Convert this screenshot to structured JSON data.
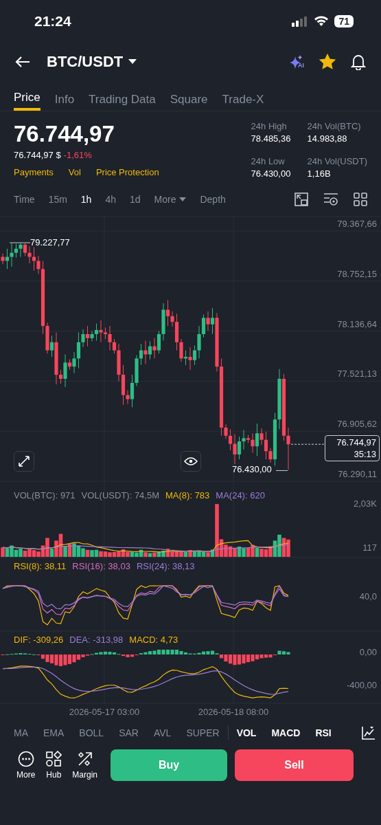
{
  "status_bar": {
    "time": "21:24",
    "battery": "71"
  },
  "header": {
    "pair": "BTC/USDT",
    "ai_label": "AI",
    "favorite": true
  },
  "tabs": [
    {
      "label": "Price",
      "selected": true
    },
    {
      "label": "Info",
      "selected": false
    },
    {
      "label": "Trading Data",
      "selected": false
    },
    {
      "label": "Square",
      "selected": false
    },
    {
      "label": "Trade-X",
      "selected": false
    }
  ],
  "price": {
    "last": "76.744,97",
    "fiat": "76.744,97 $",
    "change": "-1,61%",
    "links": [
      "Payments",
      "Vol",
      "Price Protection"
    ]
  },
  "stats": [
    {
      "label": "24h High",
      "value": "78.485,36"
    },
    {
      "label": "24h Vol(BTC)",
      "value": "14.983,88"
    },
    {
      "label": "24h Low",
      "value": "76.430,00"
    },
    {
      "label": "24h Vol(USDT)",
      "value": "1,16B"
    }
  ],
  "intervals": [
    {
      "label": "Time",
      "selected": false
    },
    {
      "label": "15m",
      "selected": false
    },
    {
      "label": "1h",
      "selected": true
    },
    {
      "label": "4h",
      "selected": false
    },
    {
      "label": "1d",
      "selected": false
    },
    {
      "label": "More",
      "selected": false,
      "kind": "dropdown"
    },
    {
      "label": "Depth",
      "selected": false
    }
  ],
  "price_chart": {
    "high_label": "79.227,77",
    "low_label": "76.430,00",
    "current_price": "76.744,97",
    "countdown": "35:13",
    "chart_data": {
      "type": "candlestick",
      "grid": true,
      "yticks": [
        {
          "value": 79367.66,
          "label": "79.367,66"
        },
        {
          "value": 78752.15,
          "label": "78.752,15"
        },
        {
          "value": 78136.64,
          "label": "78.136,64"
        },
        {
          "value": 77521.13,
          "label": "77.521,13"
        },
        {
          "value": 76905.62,
          "label": "76.905,62"
        },
        {
          "value": 76290.11,
          "label": "76.290,11"
        }
      ],
      "ylim": [
        76214.2,
        79553.7
      ],
      "ohlc": [
        [
          79050,
          79090,
          78960,
          79000
        ],
        [
          79000,
          79150,
          78900,
          79050
        ],
        [
          79050,
          79220,
          78930,
          79100
        ],
        [
          79100,
          79210,
          79040,
          79150
        ],
        [
          79150,
          79227.77,
          79050,
          79200
        ],
        [
          79200,
          79220,
          79060,
          79100
        ],
        [
          79100,
          79180,
          78970,
          79050
        ],
        [
          79050,
          79170,
          78880,
          79000
        ],
        [
          79000,
          79060,
          78840,
          78900
        ],
        [
          78900,
          79000,
          78100,
          78200
        ],
        [
          78200,
          78240,
          77860,
          77900
        ],
        [
          77900,
          78080,
          77820,
          78000
        ],
        [
          78000,
          78120,
          77480,
          77600
        ],
        [
          77600,
          77660,
          77490,
          77550
        ],
        [
          77550,
          77850,
          77450,
          77750
        ],
        [
          77750,
          77790,
          77660,
          77700
        ],
        [
          77700,
          77880,
          77620,
          77800
        ],
        [
          77800,
          78120,
          77680,
          78000
        ],
        [
          78000,
          78160,
          77940,
          78100
        ],
        [
          78100,
          78200,
          77950,
          78050
        ],
        [
          78050,
          78140,
          78010,
          78100
        ],
        [
          78100,
          78230,
          78020,
          78150
        ],
        [
          78150,
          78270,
          78000,
          78120
        ],
        [
          78120,
          78180,
          78040,
          78100
        ],
        [
          78100,
          78200,
          77900,
          78000
        ],
        [
          78000,
          78040,
          77860,
          77900
        ],
        [
          77900,
          77980,
          77520,
          77600
        ],
        [
          77600,
          77720,
          77230,
          77350
        ],
        [
          77350,
          77410,
          77240,
          77300
        ],
        [
          77300,
          77600,
          77200,
          77500
        ],
        [
          77500,
          77840,
          77460,
          77800
        ],
        [
          77800,
          77980,
          77720,
          77900
        ],
        [
          77900,
          78020,
          77730,
          77850
        ],
        [
          77850,
          78010,
          77790,
          77950
        ],
        [
          77950,
          78050,
          77800,
          77900
        ],
        [
          77900,
          78140,
          77860,
          78100
        ],
        [
          78100,
          78480,
          78020,
          78400
        ],
        [
          78400,
          78520,
          78200,
          78320
        ],
        [
          78320,
          78380,
          78190,
          78250
        ],
        [
          78250,
          78350,
          77900,
          78000
        ],
        [
          78000,
          78040,
          77760,
          77800
        ],
        [
          77800,
          77900,
          77720,
          77820
        ],
        [
          77820,
          77940,
          77660,
          77780
        ],
        [
          77780,
          77960,
          77720,
          77900
        ],
        [
          77900,
          78200,
          77800,
          78100
        ],
        [
          78100,
          78340,
          78060,
          78300
        ],
        [
          78300,
          78380,
          78140,
          78220
        ],
        [
          78220,
          78420,
          78100,
          78300
        ],
        [
          78300,
          78360,
          77640,
          77700
        ],
        [
          77700,
          77800,
          76850,
          76950
        ],
        [
          76950,
          76990,
          76810,
          76850
        ],
        [
          76850,
          76930,
          76670,
          76750
        ],
        [
          76750,
          76870,
          76500,
          76620
        ],
        [
          76620,
          76840,
          76560,
          76780
        ],
        [
          76780,
          76920,
          76680,
          76820
        ],
        [
          76820,
          76860,
          76760,
          76800
        ],
        [
          76800,
          76880,
          76640,
          76720
        ],
        [
          76720,
          77000,
          76600,
          76880
        ],
        [
          76880,
          76940,
          76740,
          76800
        ],
        [
          76800,
          76900,
          76560,
          76660
        ],
        [
          76660,
          76700,
          76520,
          76560
        ],
        [
          76560,
          77130,
          76480,
          77050
        ],
        [
          77050,
          77670,
          76930,
          77550
        ],
        [
          77550,
          77610,
          76790,
          76850
        ],
        [
          76850,
          76950,
          76430,
          76744.97
        ]
      ]
    }
  },
  "volume_panel": {
    "legend": [
      {
        "text": "VOL(BTC): 971",
        "color": "#8a8f98"
      },
      {
        "text": "VOL(USDT): 74,5M",
        "color": "#8a8f98"
      },
      {
        "text": "MA(8): 783",
        "color": "#f0b90b"
      },
      {
        "text": "MA(24): 620",
        "color": "#9b7ed9"
      }
    ],
    "ticks": [
      "2,03K",
      "117"
    ]
  },
  "rsi_panel": {
    "legend": [
      {
        "text": "RSI(8): 38,11",
        "color": "#f0b90b"
      },
      {
        "text": "RSI(16): 38,03",
        "color": "#d86bc2"
      },
      {
        "text": "RSI(24): 38,13",
        "color": "#9b7ed9"
      }
    ],
    "ticks": [
      "40,0"
    ]
  },
  "macd_panel": {
    "legend": [
      {
        "text": "DIF: -309,26",
        "color": "#f0b90b"
      },
      {
        "text": "DEA: -313,98",
        "color": "#9b7ed9"
      },
      {
        "text": "MACD: 4,73",
        "color": "#f0b90b"
      }
    ],
    "ticks": [
      "0,00",
      "-400,00"
    ]
  },
  "dates": [
    "2026-05-17 03:00",
    "2026-05-18 08:00"
  ],
  "indicators": [
    {
      "label": "MA",
      "selected": false
    },
    {
      "label": "EMA",
      "selected": false
    },
    {
      "label": "BOLL",
      "selected": false
    },
    {
      "label": "SAR",
      "selected": false
    },
    {
      "label": "AVL",
      "selected": false
    },
    {
      "label": "SUPER",
      "selected": false
    },
    {
      "label": "VOL",
      "selected": true
    },
    {
      "label": "MACD",
      "selected": true
    },
    {
      "label": "RSI",
      "selected": true
    }
  ],
  "actions": [
    {
      "label": "More",
      "kind": "more"
    },
    {
      "label": "Hub",
      "kind": "hub"
    },
    {
      "label": "Margin",
      "kind": "margin"
    }
  ],
  "buy": "Buy",
  "sell": "Sell"
}
